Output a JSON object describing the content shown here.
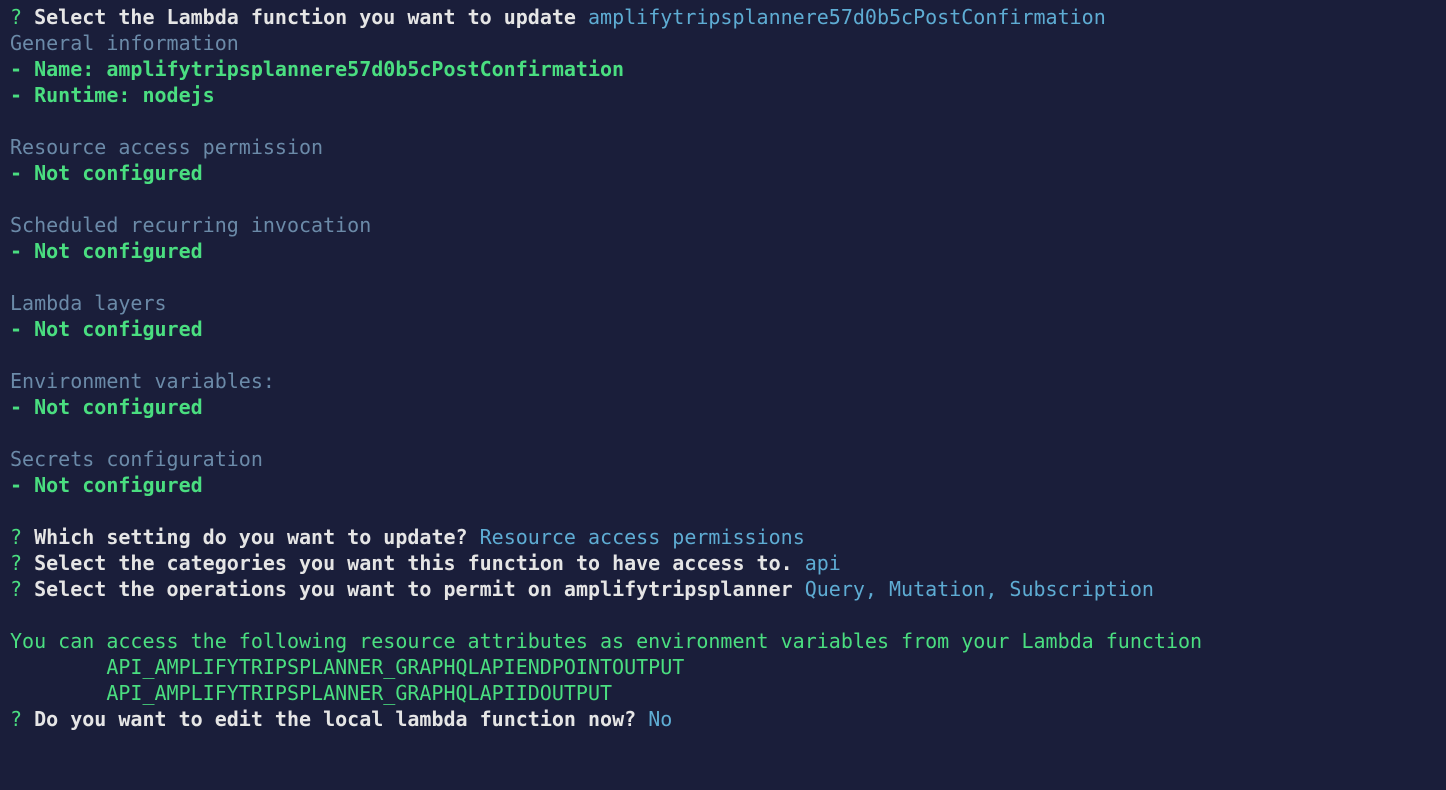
{
  "lines": [
    {
      "segments": [
        {
          "text": "? ",
          "class": "green"
        },
        {
          "text": "Select the Lambda function you want to update ",
          "class": "white-bold"
        },
        {
          "text": "amplifytripsplannere57d0b5cPostConfirmation",
          "class": "cyan"
        }
      ]
    },
    {
      "segments": [
        {
          "text": "General information",
          "class": "cyan-muted"
        }
      ]
    },
    {
      "segments": [
        {
          "text": "- Name: amplifytripsplannere57d0b5cPostConfirmation",
          "class": "green-bold"
        }
      ]
    },
    {
      "segments": [
        {
          "text": "- Runtime: nodejs",
          "class": "green-bold"
        }
      ]
    },
    {
      "blank": true
    },
    {
      "segments": [
        {
          "text": "Resource access permission",
          "class": "cyan-muted"
        }
      ]
    },
    {
      "segments": [
        {
          "text": "- Not configured",
          "class": "green-bold"
        }
      ]
    },
    {
      "blank": true
    },
    {
      "segments": [
        {
          "text": "Scheduled recurring invocation",
          "class": "cyan-muted"
        }
      ]
    },
    {
      "segments": [
        {
          "text": "- Not configured",
          "class": "green-bold"
        }
      ]
    },
    {
      "blank": true
    },
    {
      "segments": [
        {
          "text": "Lambda layers",
          "class": "cyan-muted"
        }
      ]
    },
    {
      "segments": [
        {
          "text": "- Not configured",
          "class": "green-bold"
        }
      ]
    },
    {
      "blank": true
    },
    {
      "segments": [
        {
          "text": "Environment variables:",
          "class": "cyan-muted"
        }
      ]
    },
    {
      "segments": [
        {
          "text": "- Not configured",
          "class": "green-bold"
        }
      ]
    },
    {
      "blank": true
    },
    {
      "segments": [
        {
          "text": "Secrets configuration",
          "class": "cyan-muted"
        }
      ]
    },
    {
      "segments": [
        {
          "text": "- Not configured",
          "class": "green-bold"
        }
      ]
    },
    {
      "blank": true
    },
    {
      "segments": [
        {
          "text": "? ",
          "class": "green"
        },
        {
          "text": "Which setting do you want to update? ",
          "class": "white-bold"
        },
        {
          "text": "Resource access permissions",
          "class": "cyan"
        }
      ]
    },
    {
      "segments": [
        {
          "text": "? ",
          "class": "green"
        },
        {
          "text": "Select the categories you want this function to have access to. ",
          "class": "white-bold"
        },
        {
          "text": "api",
          "class": "cyan"
        }
      ]
    },
    {
      "segments": [
        {
          "text": "? ",
          "class": "green"
        },
        {
          "text": "Select the operations you want to permit on amplifytripsplanner ",
          "class": "white-bold"
        },
        {
          "text": "Query, Mutation, Subscription",
          "class": "cyan"
        }
      ]
    },
    {
      "blank": true
    },
    {
      "segments": [
        {
          "text": "You can access the following resource attributes as environment variables from your Lambda function",
          "class": "green"
        }
      ]
    },
    {
      "segments": [
        {
          "text": "        API_AMPLIFYTRIPSPLANNER_GRAPHQLAPIENDPOINTOUTPUT",
          "class": "green"
        }
      ]
    },
    {
      "segments": [
        {
          "text": "        API_AMPLIFYTRIPSPLANNER_GRAPHQLAPIIDOUTPUT",
          "class": "green"
        }
      ]
    },
    {
      "segments": [
        {
          "text": "? ",
          "class": "green"
        },
        {
          "text": "Do you want to edit the local lambda function now? ",
          "class": "white-bold"
        },
        {
          "text": "No",
          "class": "cyan"
        }
      ]
    }
  ]
}
